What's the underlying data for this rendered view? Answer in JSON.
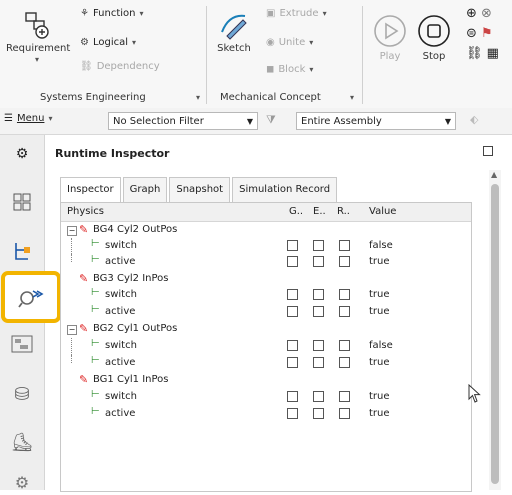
{
  "ribbon": {
    "systems_group": {
      "label": "Systems Engineering",
      "requirement": "Requirement",
      "function": "Function",
      "logical": "Logical",
      "dependency": "Dependency"
    },
    "mech_group": {
      "label": "Mechanical Concept",
      "sketch": "Sketch",
      "extrude": "Extrude",
      "unite": "Unite",
      "block": "Block"
    },
    "sim": {
      "play": "Play",
      "stop": "Stop"
    }
  },
  "toolbar": {
    "menu": "Menu",
    "selection_filter": "No Selection Filter",
    "assembly_scope": "Entire Assembly"
  },
  "panel": {
    "title": "Runtime Inspector",
    "tabs": [
      "Inspector",
      "Graph",
      "Snapshot",
      "Simulation Record"
    ],
    "columns": {
      "physics": "Physics",
      "g": "G..",
      "e": "E..",
      "r": "R..",
      "value": "Value"
    },
    "groups": [
      {
        "name": "BG4 Cyl2 OutPos",
        "items": [
          {
            "name": "switch",
            "value": "false"
          },
          {
            "name": "active",
            "value": "true"
          }
        ]
      },
      {
        "name": "BG3 Cyl2 InPos",
        "items": [
          {
            "name": "switch",
            "value": "true"
          },
          {
            "name": "active",
            "value": "true"
          }
        ]
      },
      {
        "name": "BG2 Cyl1 OutPos",
        "items": [
          {
            "name": "switch",
            "value": "false"
          },
          {
            "name": "active",
            "value": "true"
          }
        ]
      },
      {
        "name": "BG1 Cyl1 InPos",
        "items": [
          {
            "name": "switch",
            "value": "true"
          },
          {
            "name": "active",
            "value": "true"
          }
        ]
      }
    ]
  },
  "colors": {
    "highlight": "#f2b400",
    "accent_blue": "#1a57a8"
  }
}
